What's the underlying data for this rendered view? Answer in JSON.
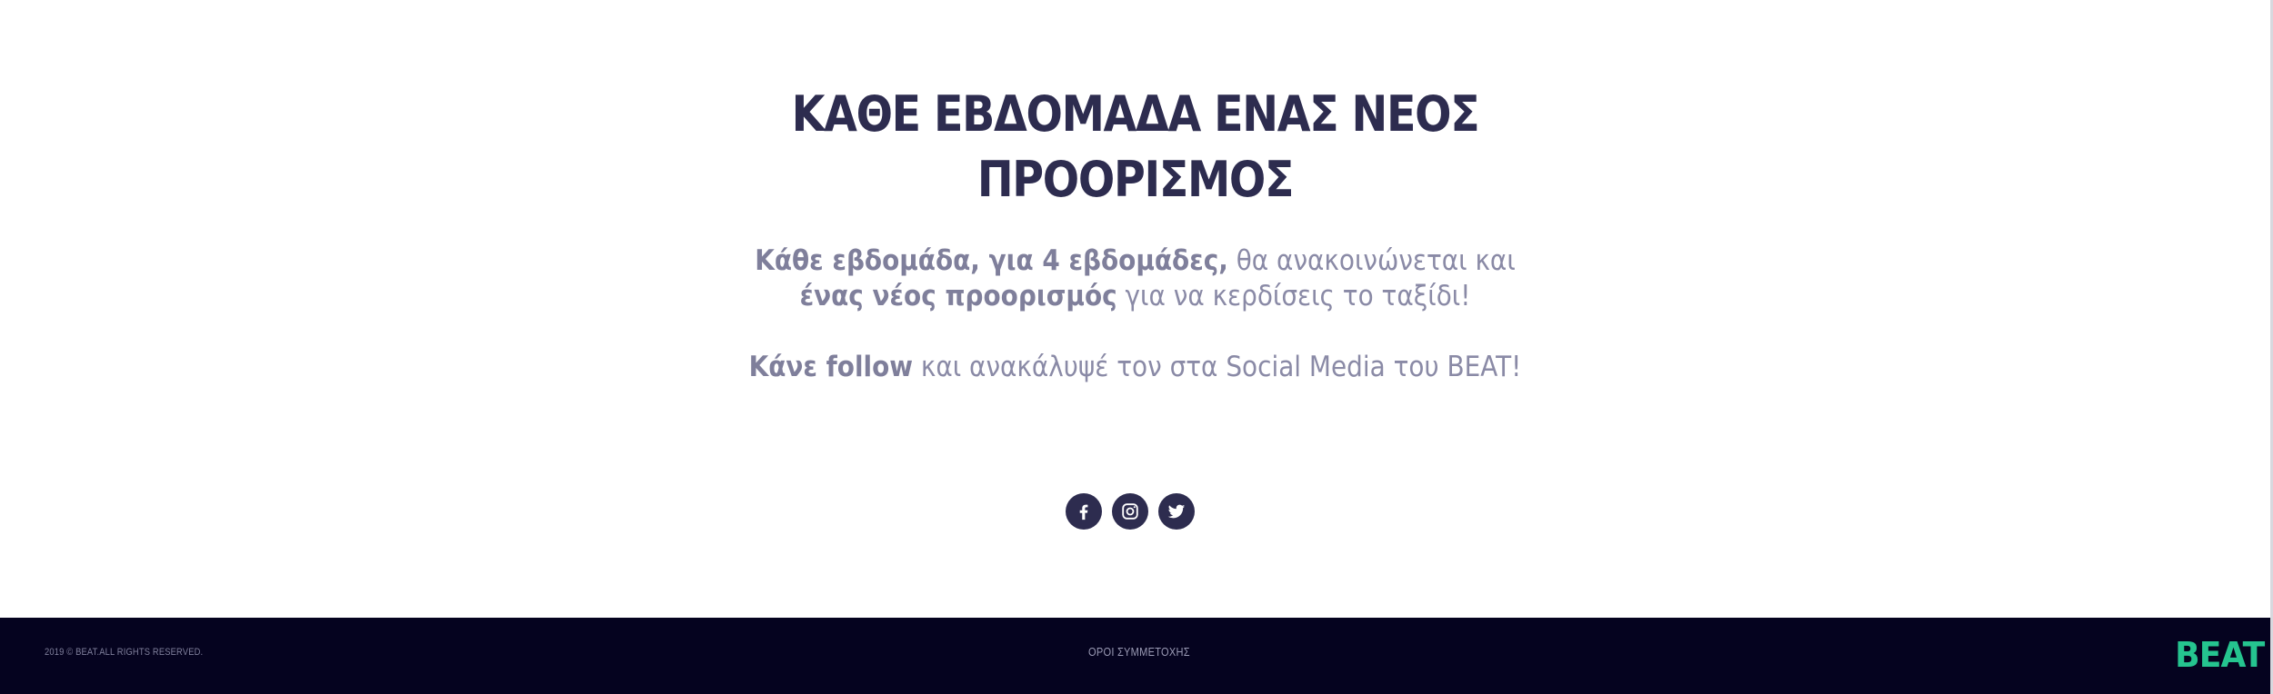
{
  "hero": {
    "title_line1": "ΚΑΘΕ ΕΒΔΟΜΑΔΑ ΕΝΑΣ ΝΕΟΣ",
    "title_line2": "ΠΡΟΟΡΙΣΜΟΣ",
    "para1": {
      "bold1": "Κάθε εβδομάδα, για 4 εβδομάδες,",
      "text1": " θα ανακοινώνεται και ",
      "bold2": "ένας νέος προορισμός",
      "text2": " για να κερδίσεις το ταξίδι!"
    },
    "para2": {
      "bold1": "Κάνε follow",
      "text1": " και ανακάλυψέ τον στα Social Media του BEAT!"
    }
  },
  "socials": [
    {
      "name": "facebook",
      "icon": "facebook-icon"
    },
    {
      "name": "instagram",
      "icon": "instagram-icon"
    },
    {
      "name": "twitter",
      "icon": "twitter-icon"
    }
  ],
  "footer": {
    "copyright": "2019 © BEAT.ALL RIGHTS RESERVED.",
    "terms_link": "ΟΡΟΙ ΣΥΜΜΕΤΟΧΗΣ",
    "logo": "BEAT"
  },
  "colors": {
    "primary": "#2d2c4f",
    "muted_text": "#8a8aa6",
    "footer_bg": "#05031f",
    "brand_green": "#25c48f"
  }
}
